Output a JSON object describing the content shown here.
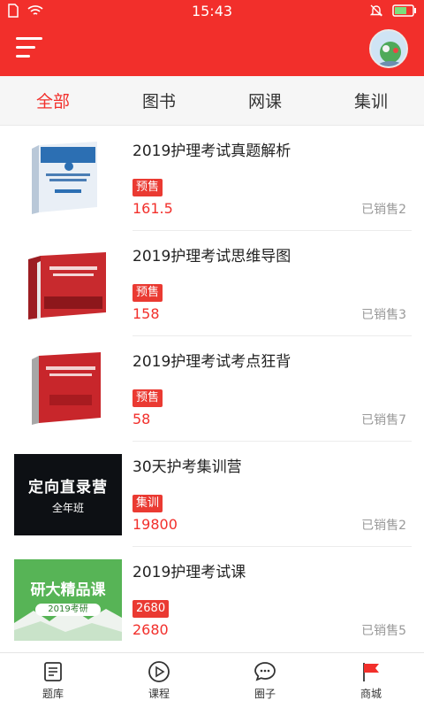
{
  "status_bar": {
    "time": "15:43"
  },
  "tabs": [
    {
      "label": "全部",
      "active": true
    },
    {
      "label": "图书",
      "active": false
    },
    {
      "label": "网课",
      "active": false
    },
    {
      "label": "集训",
      "active": false
    }
  ],
  "products": [
    {
      "title": "2019护理考试真题解析",
      "badge": "预售",
      "price": "161.5",
      "sold": "已销售2",
      "thumb": "book-blue-icon"
    },
    {
      "title": "2019护理考试思维导图",
      "badge": "预售",
      "price": "158",
      "sold": "已销售3",
      "thumb": "book-red-set-icon"
    },
    {
      "title": "2019护理考试考点狂背",
      "badge": "预售",
      "price": "58",
      "sold": "已销售7",
      "thumb": "book-red-icon"
    },
    {
      "title": "30天护考集训营",
      "badge": "集训",
      "price": "19800",
      "sold": "已销售2",
      "thumb": "camp-banner",
      "banner": {
        "line1": "定向直录营",
        "line2": "全年班"
      }
    },
    {
      "title": "2019护理考试课",
      "badge": "2680",
      "price": "2680",
      "sold": "已销售5",
      "thumb": "course-banner",
      "banner": {
        "line1": "研大精品课",
        "line2": "2019考研"
      }
    }
  ],
  "bottom_nav": [
    {
      "label": "题库",
      "icon": "question-bank-icon"
    },
    {
      "label": "课程",
      "icon": "play-circle-icon"
    },
    {
      "label": "圈子",
      "icon": "chat-bubble-icon"
    },
    {
      "label": "商城",
      "icon": "flag-icon"
    }
  ],
  "colors": {
    "brand_red": "#f22f2b",
    "badge_red": "#ea3a32",
    "muted": "#999999"
  }
}
